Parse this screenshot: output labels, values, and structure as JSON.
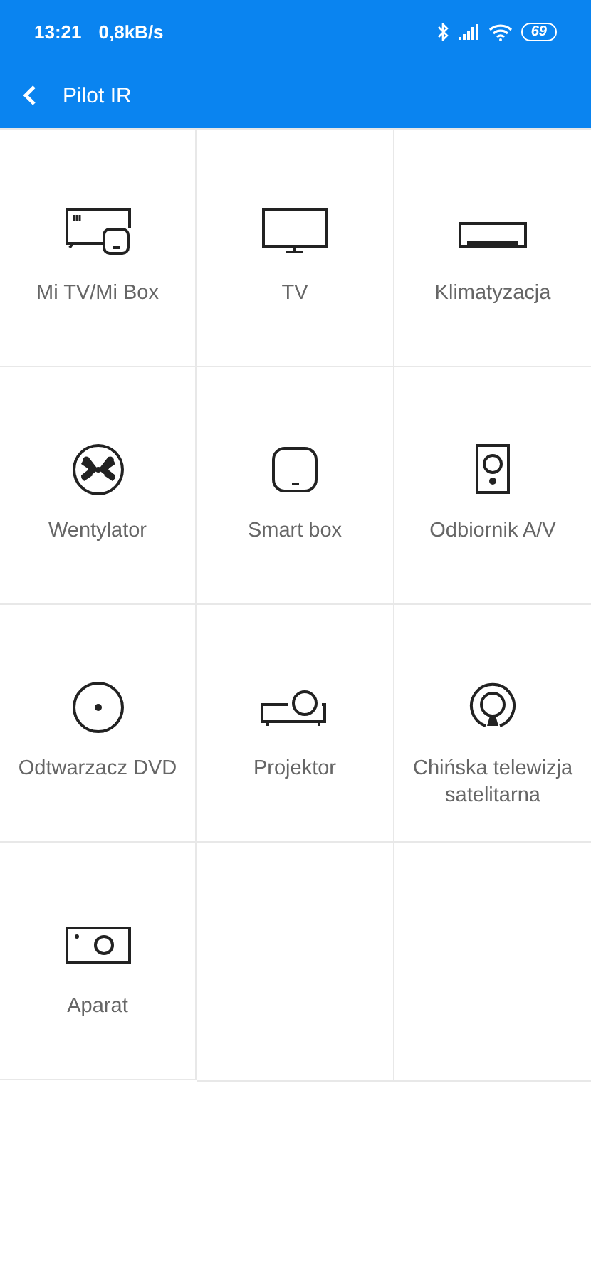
{
  "status_bar": {
    "time": "13:21",
    "speed": "0,8kB/s",
    "battery": "69"
  },
  "toolbar": {
    "title": "Pilot IR"
  },
  "devices": [
    {
      "label": "Mi TV/Mi Box",
      "kind": "mitv"
    },
    {
      "label": "TV",
      "kind": "tv"
    },
    {
      "label": "Klimatyzacja",
      "kind": "ac"
    },
    {
      "label": "Wentylator",
      "kind": "fan"
    },
    {
      "label": "Smart box",
      "kind": "box"
    },
    {
      "label": "Odbiornik A/V",
      "kind": "speaker"
    },
    {
      "label": "Odtwarzacz DVD",
      "kind": "dvd"
    },
    {
      "label": "Projektor",
      "kind": "projector"
    },
    {
      "label": "Chińska telewizja satelitarna",
      "kind": "satellite"
    },
    {
      "label": "Aparat",
      "kind": "camera"
    }
  ]
}
